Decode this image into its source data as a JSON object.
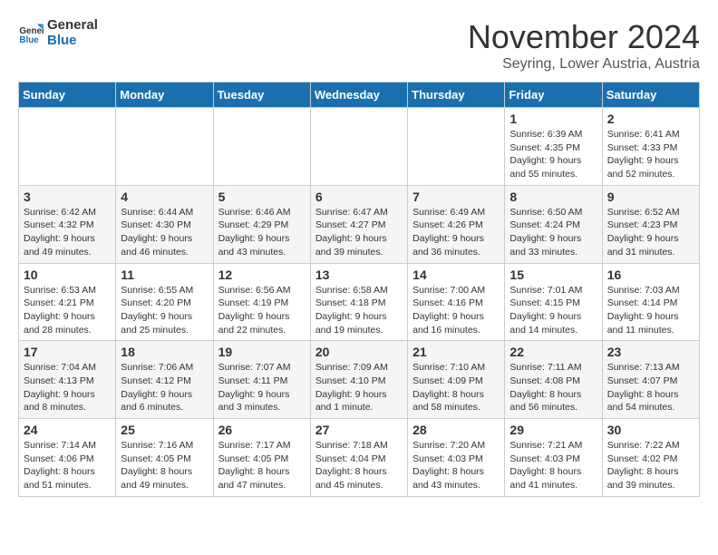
{
  "logo": {
    "text_general": "General",
    "text_blue": "Blue"
  },
  "title": "November 2024",
  "subtitle": "Seyring, Lower Austria, Austria",
  "days_of_week": [
    "Sunday",
    "Monday",
    "Tuesday",
    "Wednesday",
    "Thursday",
    "Friday",
    "Saturday"
  ],
  "weeks": [
    [
      {
        "day": "",
        "info": ""
      },
      {
        "day": "",
        "info": ""
      },
      {
        "day": "",
        "info": ""
      },
      {
        "day": "",
        "info": ""
      },
      {
        "day": "",
        "info": ""
      },
      {
        "day": "1",
        "info": "Sunrise: 6:39 AM\nSunset: 4:35 PM\nDaylight: 9 hours\nand 55 minutes."
      },
      {
        "day": "2",
        "info": "Sunrise: 6:41 AM\nSunset: 4:33 PM\nDaylight: 9 hours\nand 52 minutes."
      }
    ],
    [
      {
        "day": "3",
        "info": "Sunrise: 6:42 AM\nSunset: 4:32 PM\nDaylight: 9 hours\nand 49 minutes."
      },
      {
        "day": "4",
        "info": "Sunrise: 6:44 AM\nSunset: 4:30 PM\nDaylight: 9 hours\nand 46 minutes."
      },
      {
        "day": "5",
        "info": "Sunrise: 6:46 AM\nSunset: 4:29 PM\nDaylight: 9 hours\nand 43 minutes."
      },
      {
        "day": "6",
        "info": "Sunrise: 6:47 AM\nSunset: 4:27 PM\nDaylight: 9 hours\nand 39 minutes."
      },
      {
        "day": "7",
        "info": "Sunrise: 6:49 AM\nSunset: 4:26 PM\nDaylight: 9 hours\nand 36 minutes."
      },
      {
        "day": "8",
        "info": "Sunrise: 6:50 AM\nSunset: 4:24 PM\nDaylight: 9 hours\nand 33 minutes."
      },
      {
        "day": "9",
        "info": "Sunrise: 6:52 AM\nSunset: 4:23 PM\nDaylight: 9 hours\nand 31 minutes."
      }
    ],
    [
      {
        "day": "10",
        "info": "Sunrise: 6:53 AM\nSunset: 4:21 PM\nDaylight: 9 hours\nand 28 minutes."
      },
      {
        "day": "11",
        "info": "Sunrise: 6:55 AM\nSunset: 4:20 PM\nDaylight: 9 hours\nand 25 minutes."
      },
      {
        "day": "12",
        "info": "Sunrise: 6:56 AM\nSunset: 4:19 PM\nDaylight: 9 hours\nand 22 minutes."
      },
      {
        "day": "13",
        "info": "Sunrise: 6:58 AM\nSunset: 4:18 PM\nDaylight: 9 hours\nand 19 minutes."
      },
      {
        "day": "14",
        "info": "Sunrise: 7:00 AM\nSunset: 4:16 PM\nDaylight: 9 hours\nand 16 minutes."
      },
      {
        "day": "15",
        "info": "Sunrise: 7:01 AM\nSunset: 4:15 PM\nDaylight: 9 hours\nand 14 minutes."
      },
      {
        "day": "16",
        "info": "Sunrise: 7:03 AM\nSunset: 4:14 PM\nDaylight: 9 hours\nand 11 minutes."
      }
    ],
    [
      {
        "day": "17",
        "info": "Sunrise: 7:04 AM\nSunset: 4:13 PM\nDaylight: 9 hours\nand 8 minutes."
      },
      {
        "day": "18",
        "info": "Sunrise: 7:06 AM\nSunset: 4:12 PM\nDaylight: 9 hours\nand 6 minutes."
      },
      {
        "day": "19",
        "info": "Sunrise: 7:07 AM\nSunset: 4:11 PM\nDaylight: 9 hours\nand 3 minutes."
      },
      {
        "day": "20",
        "info": "Sunrise: 7:09 AM\nSunset: 4:10 PM\nDaylight: 9 hours\nand 1 minute."
      },
      {
        "day": "21",
        "info": "Sunrise: 7:10 AM\nSunset: 4:09 PM\nDaylight: 8 hours\nand 58 minutes."
      },
      {
        "day": "22",
        "info": "Sunrise: 7:11 AM\nSunset: 4:08 PM\nDaylight: 8 hours\nand 56 minutes."
      },
      {
        "day": "23",
        "info": "Sunrise: 7:13 AM\nSunset: 4:07 PM\nDaylight: 8 hours\nand 54 minutes."
      }
    ],
    [
      {
        "day": "24",
        "info": "Sunrise: 7:14 AM\nSunset: 4:06 PM\nDaylight: 8 hours\nand 51 minutes."
      },
      {
        "day": "25",
        "info": "Sunrise: 7:16 AM\nSunset: 4:05 PM\nDaylight: 8 hours\nand 49 minutes."
      },
      {
        "day": "26",
        "info": "Sunrise: 7:17 AM\nSunset: 4:05 PM\nDaylight: 8 hours\nand 47 minutes."
      },
      {
        "day": "27",
        "info": "Sunrise: 7:18 AM\nSunset: 4:04 PM\nDaylight: 8 hours\nand 45 minutes."
      },
      {
        "day": "28",
        "info": "Sunrise: 7:20 AM\nSunset: 4:03 PM\nDaylight: 8 hours\nand 43 minutes."
      },
      {
        "day": "29",
        "info": "Sunrise: 7:21 AM\nSunset: 4:03 PM\nDaylight: 8 hours\nand 41 minutes."
      },
      {
        "day": "30",
        "info": "Sunrise: 7:22 AM\nSunset: 4:02 PM\nDaylight: 8 hours\nand 39 minutes."
      }
    ]
  ]
}
